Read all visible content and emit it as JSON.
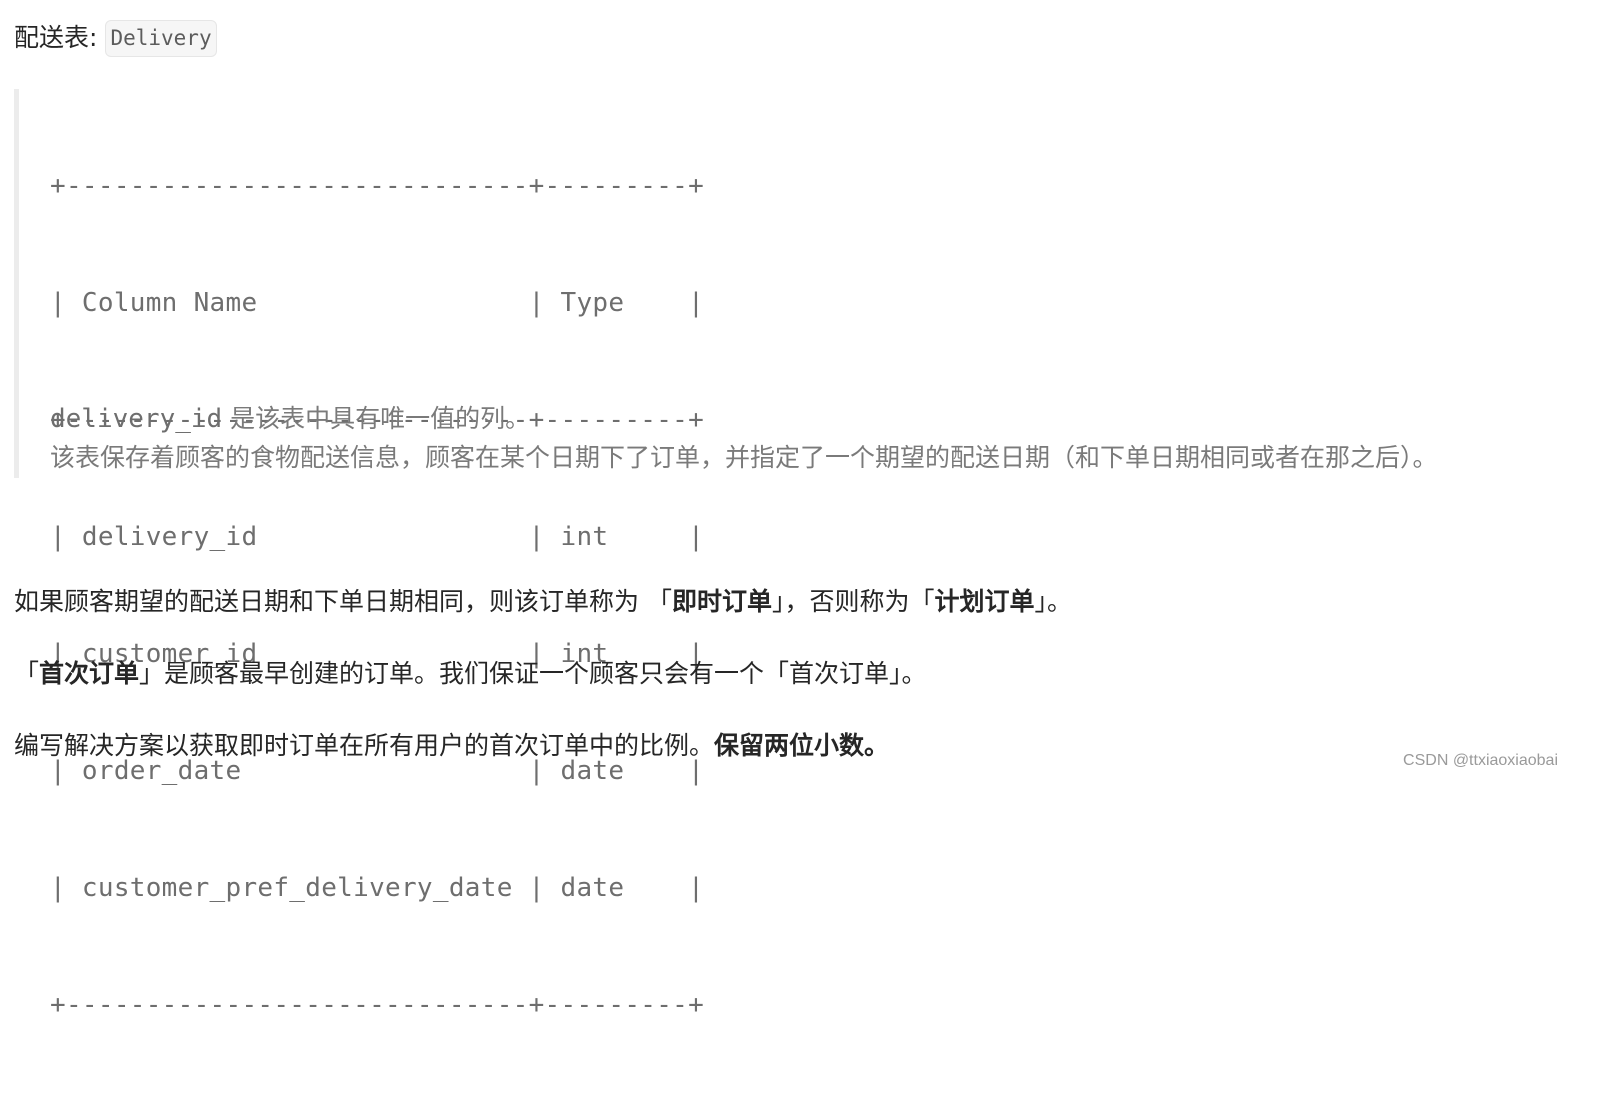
{
  "heading": {
    "label": "配送表: ",
    "table_name": "Delivery"
  },
  "schema": {
    "border": "+-----------------------------+---------+",
    "header": "| Column Name                 | Type    |",
    "rows": [
      "| delivery_id                 | int     |",
      "| customer_id                 | int     |",
      "| order_date                  | date    |",
      "| customer_pref_delivery_date | date    |"
    ],
    "columns": [
      {
        "name": "delivery_id",
        "type": "int"
      },
      {
        "name": "customer_id",
        "type": "int"
      },
      {
        "name": "order_date",
        "type": "date"
      },
      {
        "name": "customer_pref_delivery_date",
        "type": "date"
      }
    ],
    "note_key": "delivery_id",
    "note_1_rest": " 是该表中具有唯一值的列。",
    "note_2": "该表保存着顾客的食物配送信息，顾客在某个日期下了订单，并指定了一个期望的配送日期（和下单日期相同或者在那之后）。"
  },
  "paragraphs": {
    "p1_a": "如果顾客期望的配送日期和下单日期相同，则该订单称为 「",
    "p1_b_bold": "即时订单",
    "p1_c": "」，否则称为「",
    "p1_d_bold": "计划订单",
    "p1_e": "」。",
    "p2_a": "「",
    "p2_b_bold": "首次订单",
    "p2_c": "」是顾客最早创建的订单。我们保证一个顾客只会有一个「首次订单」。",
    "p3_a": "编写解决方案以获取即时订单在所有用户的首次订单中的比例。",
    "p3_b_bold": "保留两位小数。"
  },
  "watermark": "CSDN @ttxiaoxiaobai"
}
